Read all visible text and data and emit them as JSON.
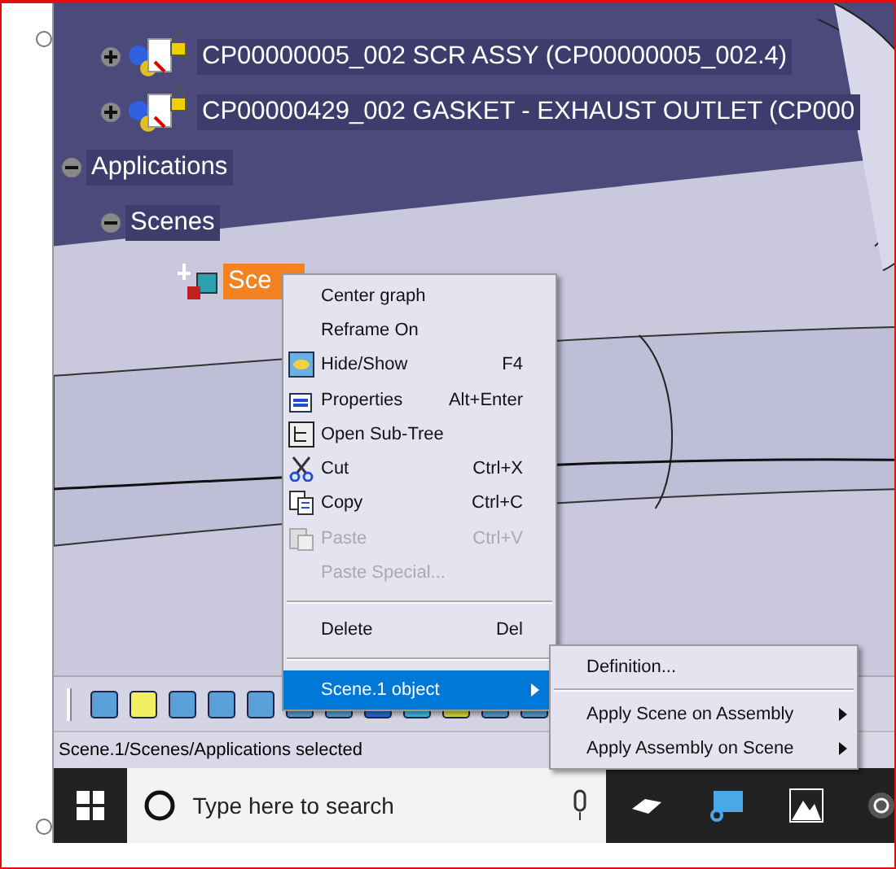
{
  "tree": {
    "parts": [
      {
        "label": "CP00000005_002 SCR ASSY (CP00000005_002.4)",
        "expanded": false,
        "locked": true
      },
      {
        "label": "CP00000429_002 GASKET - EXHAUST OUTLET (CP000",
        "expanded": false,
        "locked": true
      }
    ],
    "applications": {
      "label": "Applications",
      "expanded": true,
      "children": [
        {
          "label": "Scenes",
          "expanded": true,
          "children": [
            {
              "label": "Sce",
              "selected": true
            }
          ]
        }
      ]
    }
  },
  "context_menu": {
    "items": [
      {
        "kind": "item",
        "label": "Center graph",
        "disabled": false
      },
      {
        "kind": "item",
        "label": "Reframe On",
        "disabled": false
      },
      {
        "kind": "item",
        "label": "Hide/Show",
        "shortcut": "F4",
        "disabled": false
      },
      {
        "kind": "item",
        "label": "Properties",
        "shortcut": "Alt+Enter",
        "disabled": false
      },
      {
        "kind": "item",
        "label": "Open Sub-Tree",
        "disabled": false
      },
      {
        "kind": "item",
        "label": "Cut",
        "shortcut": "Ctrl+X",
        "disabled": false
      },
      {
        "kind": "item",
        "label": "Copy",
        "shortcut": "Ctrl+C",
        "disabled": false
      },
      {
        "kind": "item",
        "label": "Paste",
        "shortcut": "Ctrl+V",
        "disabled": true
      },
      {
        "kind": "item",
        "label": "Paste Special...",
        "disabled": true
      },
      {
        "kind": "separator"
      },
      {
        "kind": "item",
        "label": "Delete",
        "shortcut": "Del",
        "disabled": false
      },
      {
        "kind": "separator"
      },
      {
        "kind": "submenu",
        "label": "Scene.1 object",
        "selected": true
      }
    ]
  },
  "submenu": {
    "items": [
      {
        "kind": "item",
        "label": "Definition..."
      },
      {
        "kind": "separator"
      },
      {
        "kind": "submenu",
        "label": "Apply Scene on Assembly"
      },
      {
        "kind": "submenu",
        "label": "Apply Assembly on Scene"
      }
    ]
  },
  "status_bar": {
    "text": "Scene.1/Scenes/Applications selected"
  },
  "taskbar": {
    "search": {
      "placeholder": "Type here to search"
    }
  }
}
